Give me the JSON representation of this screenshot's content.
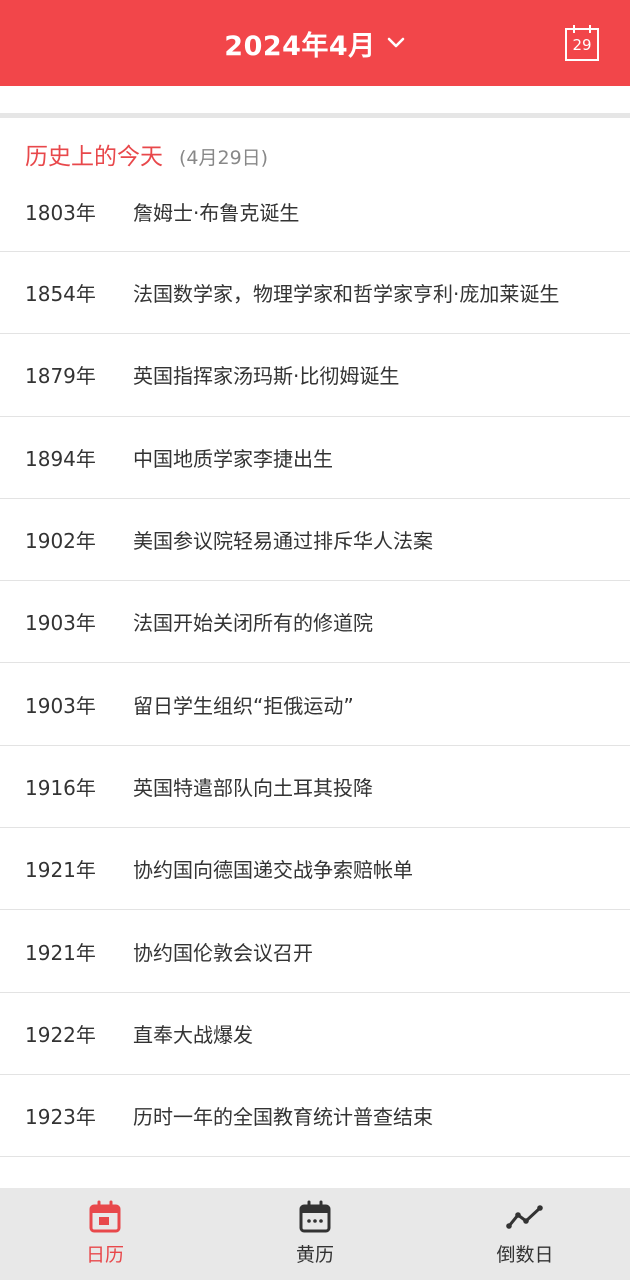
{
  "header": {
    "title": "2024年4月",
    "today_day": "29",
    "bg_color": "#f2464a"
  },
  "history": {
    "title": "历史上的今天",
    "date": "(4月29日)",
    "items": [
      {
        "year": "1803年",
        "event": "詹姆士·布鲁克诞生"
      },
      {
        "year": "1854年",
        "event": "法国数学家，物理学家和哲学家亨利·庞加莱诞生"
      },
      {
        "year": "1879年",
        "event": "英国指挥家汤玛斯·比彻姆诞生"
      },
      {
        "year": "1894年",
        "event": "中国地质学家李捷出生"
      },
      {
        "year": "1902年",
        "event": "美国参议院轻易通过排斥华人法案"
      },
      {
        "year": "1903年",
        "event": "法国开始关闭所有的修道院"
      },
      {
        "year": "1903年",
        "event": "留日学生组织“拒俄运动”"
      },
      {
        "year": "1916年",
        "event": "英国特遣部队向土耳其投降"
      },
      {
        "year": "1921年",
        "event": "协约国向德国递交战争索赔帐单"
      },
      {
        "year": "1921年",
        "event": "协约国伦敦会议召开"
      },
      {
        "year": "1922年",
        "event": "直奉大战爆发"
      },
      {
        "year": "1923年",
        "event": "历时一年的全国教育统计普查结束"
      }
    ]
  },
  "nav": {
    "items": [
      {
        "label": "日历",
        "icon": "calendar-icon",
        "active": true
      },
      {
        "label": "黄历",
        "icon": "almanac-icon",
        "active": false
      },
      {
        "label": "倒数日",
        "icon": "countdown-icon",
        "active": false
      }
    ],
    "active_color": "#e8484b"
  }
}
